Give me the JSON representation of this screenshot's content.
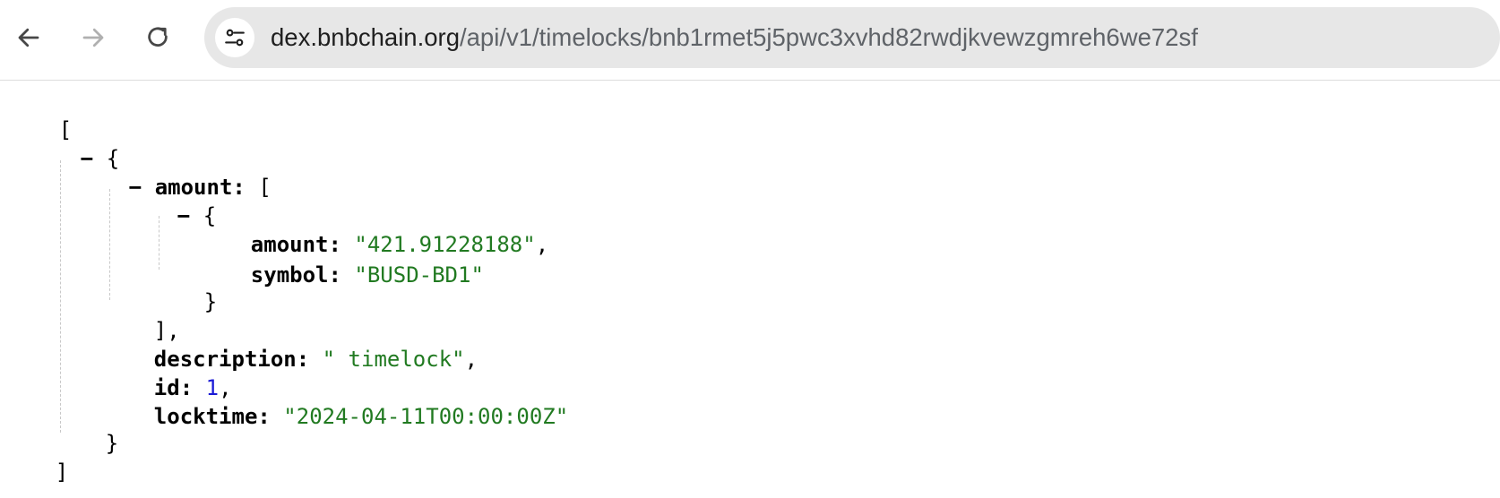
{
  "browser": {
    "url_host": "dex.bnbchain.org",
    "url_path": "/api/v1/timelocks/bnb1rmet5j5pwc3xvhd82rwdjkvewzgmreh6we72sf"
  },
  "json": {
    "root_open": "[",
    "root_close": "]",
    "obj_open": "{",
    "obj_close": "}",
    "amount_key": "amount",
    "amount_array_open": "[",
    "amount_array_close": "],",
    "inner_obj_open": "{",
    "inner_obj_close": "}",
    "inner_amount_key": "amount",
    "inner_amount_value": "\"421.91228188\"",
    "symbol_key": "symbol",
    "symbol_value": "\"BUSD-BD1\"",
    "description_key": "description",
    "description_value": "\" timelock\"",
    "id_key": "id",
    "id_value": "1",
    "locktime_key": "locktime",
    "locktime_value": "\"2024-04-11T00:00:00Z\"",
    "collapse_symbol": "−"
  },
  "colors": {
    "string": "#217a21",
    "number": "#1a1ad6",
    "key": "#000000"
  }
}
